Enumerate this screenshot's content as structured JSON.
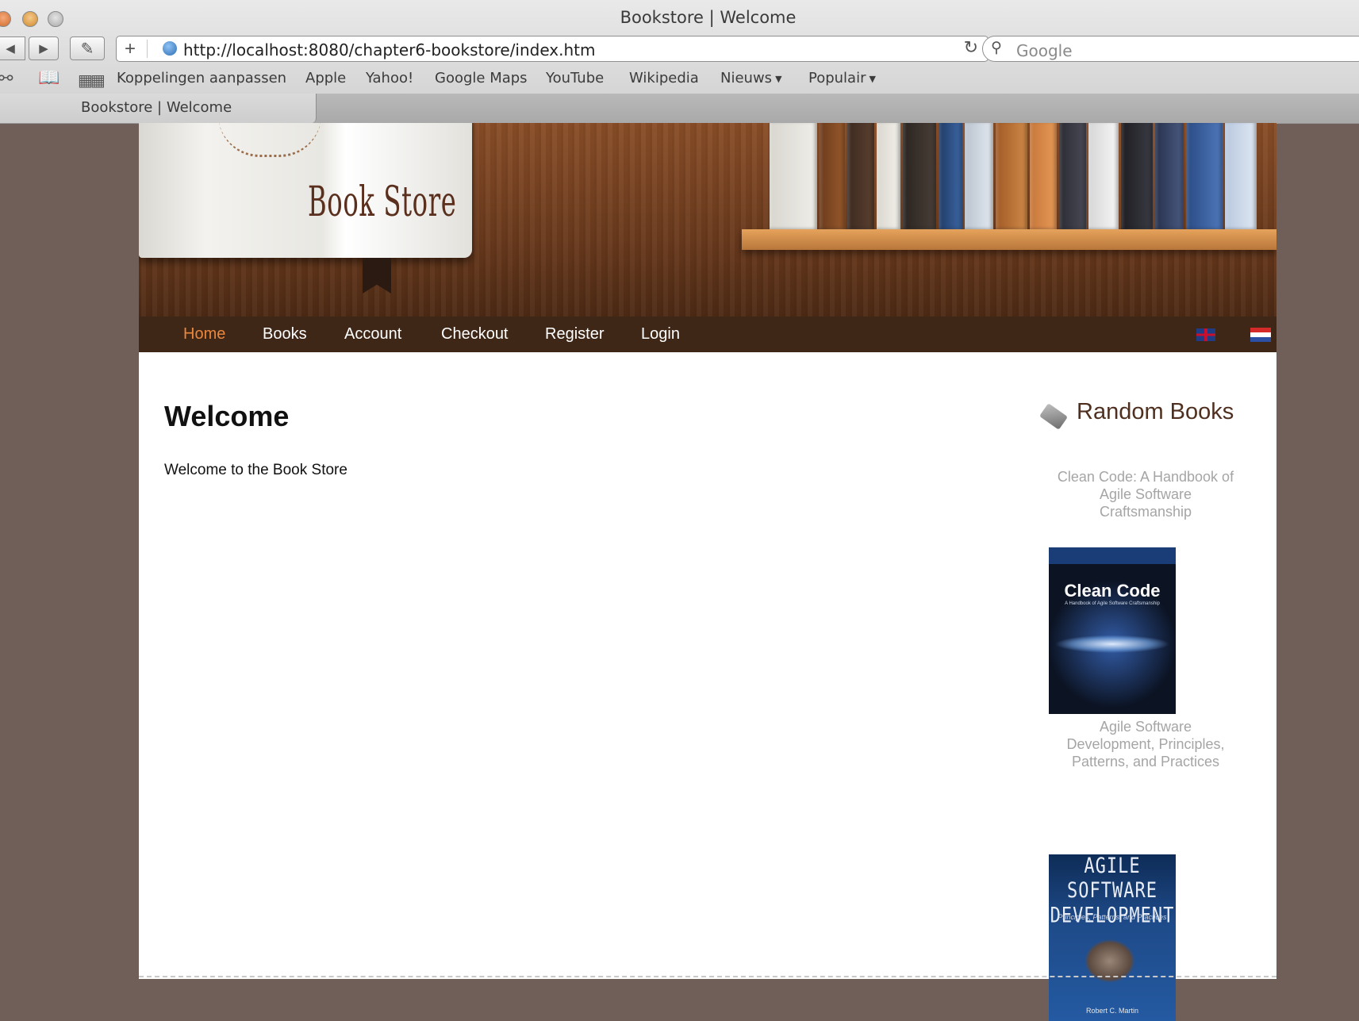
{
  "browser": {
    "window_title": "Bookstore | Welcome",
    "url": "http://localhost:8080/chapter6-bookstore/index.htm",
    "search_placeholder": "Google",
    "bookmarks": [
      "Koppelingen aanpassen",
      "Apple",
      "Yahoo!",
      "Google Maps",
      "YouTube",
      "Wikipedia"
    ],
    "bookmark_menus": [
      "Nieuws",
      "Populair"
    ],
    "tab_title": "Bookstore | Welcome"
  },
  "header": {
    "logo_text": "Book Store",
    "nav": [
      "Home",
      "Books",
      "Account",
      "Checkout",
      "Register",
      "Login"
    ],
    "active_nav": "Home",
    "languages": [
      "English",
      "Dutch"
    ]
  },
  "main": {
    "heading": "Welcome",
    "text": "Welcome to the Book Store"
  },
  "sidebar": {
    "title": "Random Books",
    "books": [
      {
        "title": "Clean Code: A Handbook of Agile Software Craftsmanship",
        "cover_title": "Clean Code",
        "cover_subtitle": "A Handbook of Agile Software Craftsmanship"
      },
      {
        "title": "Agile Software Development, Principles, Patterns, and Practices",
        "cover_title": "AGILE SOFTWARE DEVELOPMENT",
        "cover_subtitle": "Principles, Patterns, and Practices",
        "cover_author": "Robert C. Martin"
      }
    ]
  },
  "colors": {
    "page_background": "#6f5f58",
    "nav_background": "#3f2718",
    "nav_active": "#e8873e",
    "sidebar_title": "#4f2f1f",
    "book_title": "#a5a5a5"
  }
}
